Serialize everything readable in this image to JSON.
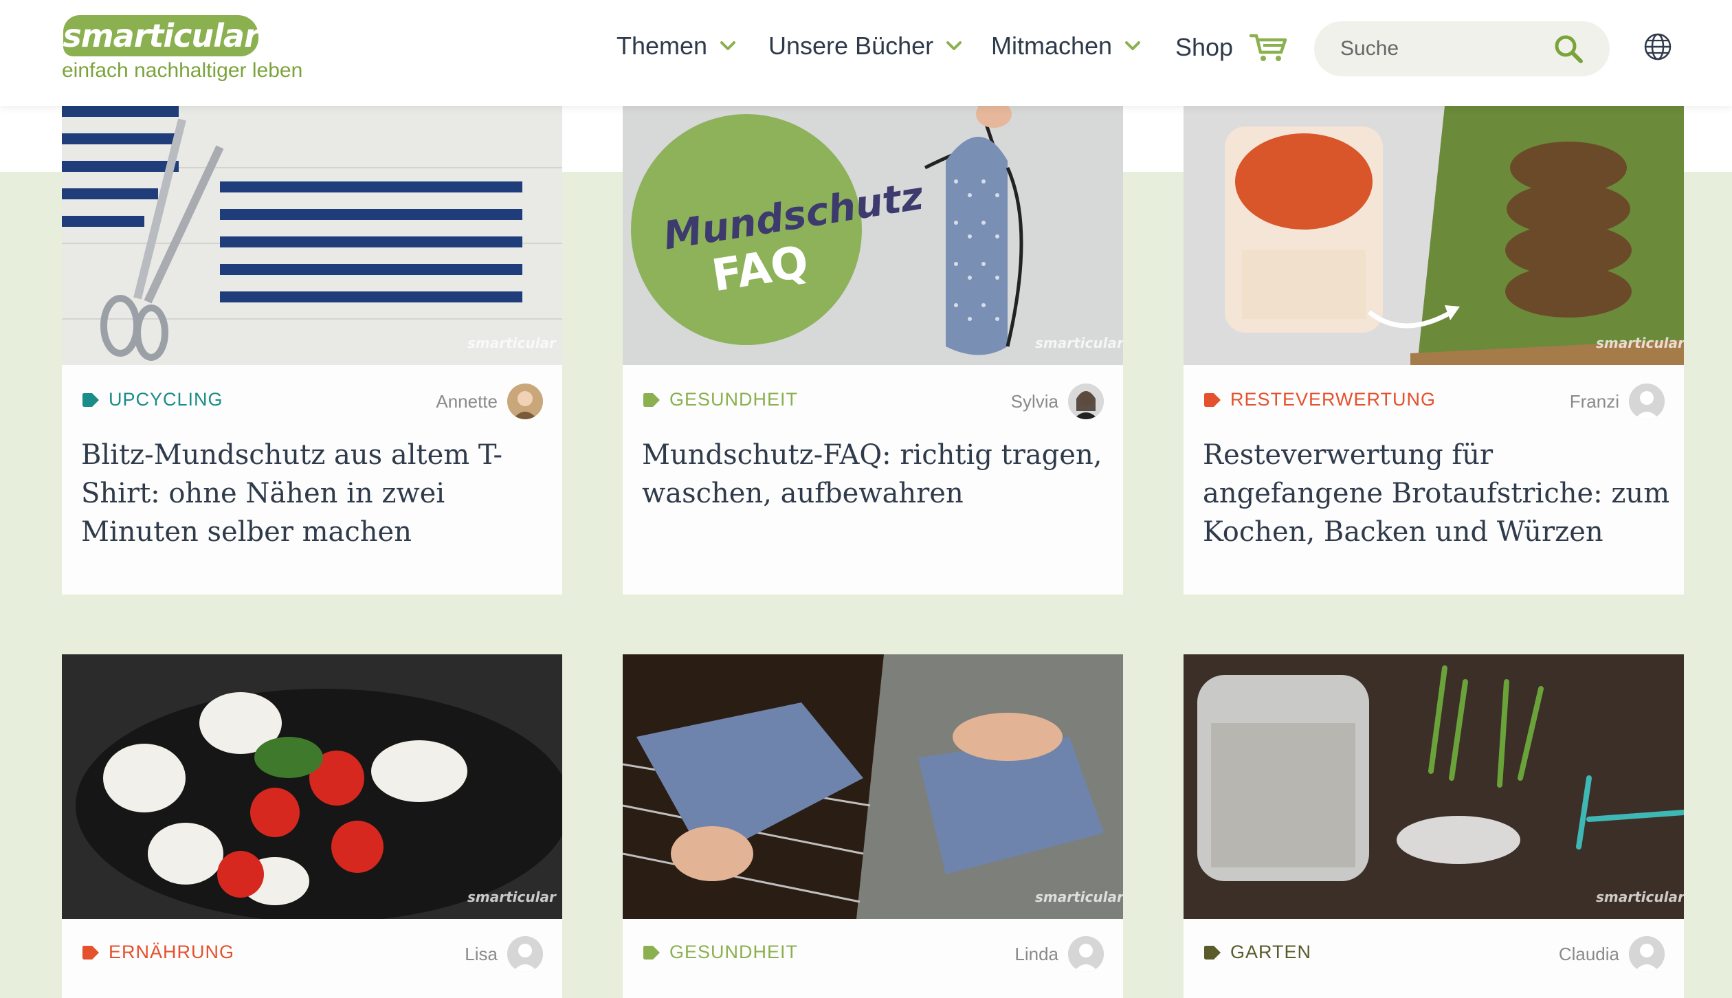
{
  "brand": {
    "name": "smarticular",
    "tagline": "einfach nachhaltiger leben"
  },
  "nav": {
    "items": [
      {
        "label": "Themen"
      },
      {
        "label": "Unsere Bücher"
      },
      {
        "label": "Mitmachen"
      }
    ],
    "shop_label": "Shop"
  },
  "search": {
    "placeholder": "Suche"
  },
  "colors": {
    "brand_green": "#8bb04f",
    "upcycling": "#1a8c8a",
    "gesundheit": "#8bb04f",
    "resteverwertung": "#e4512d",
    "ernaehrung": "#e4512d",
    "garten": "#5a5a2a",
    "page_band": "#e7eedc"
  },
  "articles": [
    {
      "category": "UPCYCLING",
      "author": "Annette",
      "title": "Blitz-Mundschutz aus altem T-Shirt: ohne Nähen in zwei Minuten selber machen",
      "watermark": "smarticular"
    },
    {
      "category": "GESUNDHEIT",
      "author": "Sylvia",
      "title": "Mundschutz-FAQ: richtig tragen, waschen, aufbewahren",
      "image_text_1": "Mundschutz",
      "image_text_2": "FAQ",
      "watermark": "smarticular"
    },
    {
      "category": "RESTEVERWERTUNG",
      "author": "Franzi",
      "title": "Resteverwertung für angefangene Brotaufstriche: zum Kochen, Backen und Würzen",
      "watermark": "smarticular"
    },
    {
      "category": "ERNÄHRUNG",
      "author": "Lisa",
      "title": "",
      "watermark": "smarticular"
    },
    {
      "category": "GESUNDHEIT",
      "author": "Linda",
      "title": "",
      "watermark": "smarticular"
    },
    {
      "category": "GARTEN",
      "author": "Claudia",
      "title": "",
      "watermark": "smarticular"
    }
  ]
}
